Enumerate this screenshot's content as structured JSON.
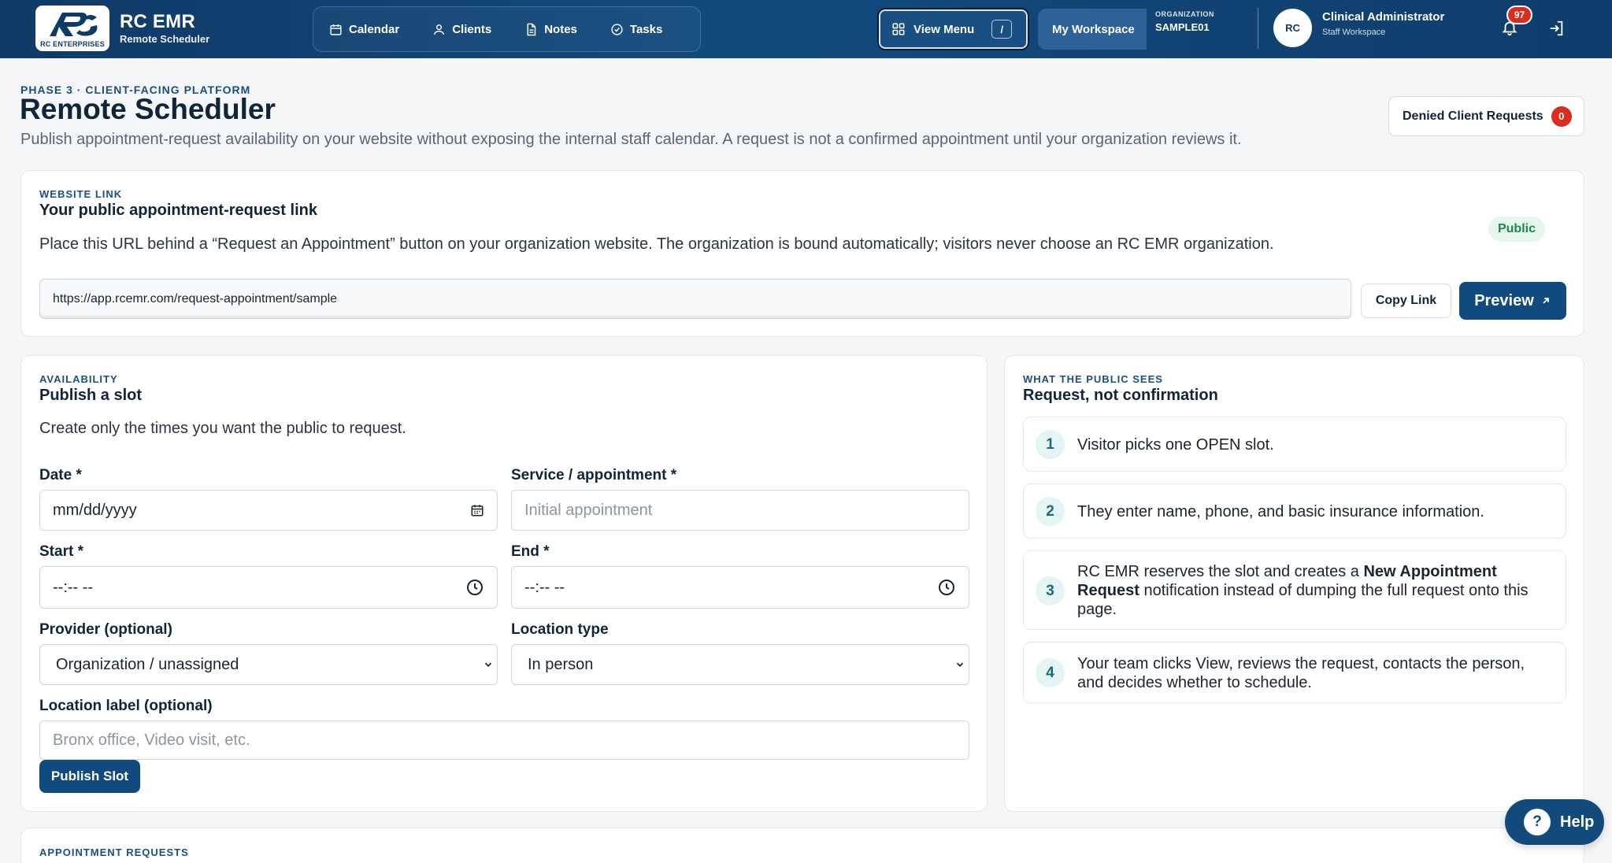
{
  "topbar": {
    "brand_title": "RC EMR",
    "brand_sub": "Remote Scheduler",
    "logo_text": "RC ENTERPRISES",
    "nav": [
      {
        "label": "Calendar",
        "icon": "calendar-icon"
      },
      {
        "label": "Clients",
        "icon": "user-icon"
      },
      {
        "label": "Notes",
        "icon": "document-icon"
      },
      {
        "label": "Tasks",
        "icon": "check-circle-icon"
      }
    ],
    "view_menu_label": "View Menu",
    "view_menu_shortcut": "/",
    "workspace_label": "My Workspace",
    "org_caption": "ORGANIZATION",
    "org_value": "SAMPLE01",
    "avatar_initials": "RC",
    "user_name": "Clinical Administrator",
    "user_sub": "Staff Workspace",
    "notification_count": "97"
  },
  "header": {
    "eyebrow": "PHASE 3 · CLIENT-FACING PLATFORM",
    "title": "Remote Scheduler",
    "description": "Publish appointment-request availability on your website without exposing the internal staff calendar. A request is not a confirmed appointment until your organization reviews it.",
    "denied_label": "Denied Client Requests",
    "denied_count": "0"
  },
  "website_link": {
    "eyebrow": "WEBSITE LINK",
    "title": "Your public appointment-request link",
    "description": "Place this URL behind a “Request an Appointment” button on your organization website. The organization is bound automatically; visitors never choose an RC EMR organization.",
    "badge": "Public",
    "url": "https://app.rcemr.com/request-appointment/sample",
    "copy_label": "Copy Link",
    "preview_label": "Preview"
  },
  "availability": {
    "eyebrow": "AVAILABILITY",
    "title": "Publish a slot",
    "description": "Create only the times you want the public to request.",
    "date_label": "Date *",
    "date_placeholder": "mm/dd/yyyy",
    "service_label": "Service / appointment *",
    "service_placeholder": "Initial appointment",
    "start_label": "Start *",
    "start_placeholder": "--:-- --",
    "end_label": "End *",
    "end_placeholder": "--:-- --",
    "provider_label": "Provider (optional)",
    "provider_value": "Organization / unassigned",
    "location_type_label": "Location type",
    "location_type_value": "In person",
    "location_label_label": "Location label (optional)",
    "location_label_placeholder": "Bronx office, Video visit, etc.",
    "publish_label": "Publish Slot"
  },
  "public_view": {
    "eyebrow": "WHAT THE PUBLIC SEES",
    "title": "Request, not confirmation",
    "steps": [
      {
        "num": "1",
        "text": "Visitor picks one OPEN slot."
      },
      {
        "num": "2",
        "text": "They enter name, phone, and basic insurance information."
      },
      {
        "num": "3",
        "text_a": "RC EMR reserves the slot and creates a ",
        "text_b": "New Appointment Request",
        "text_c": " notification instead of dumping the full request onto this page."
      },
      {
        "num": "4",
        "text": "Your team clicks View, reviews the request, contacts the person, and decides whether to schedule."
      }
    ]
  },
  "requests": {
    "eyebrow": "APPOINTMENT REQUESTS"
  },
  "help": {
    "label": "Help",
    "glyph": "?"
  },
  "colors": {
    "topbar": "#124a7e",
    "primary_button": "#114a7e",
    "badge_red": "#d92d20",
    "public_green": "#1c8a47",
    "eyebrow_blue": "#1a4f84"
  }
}
